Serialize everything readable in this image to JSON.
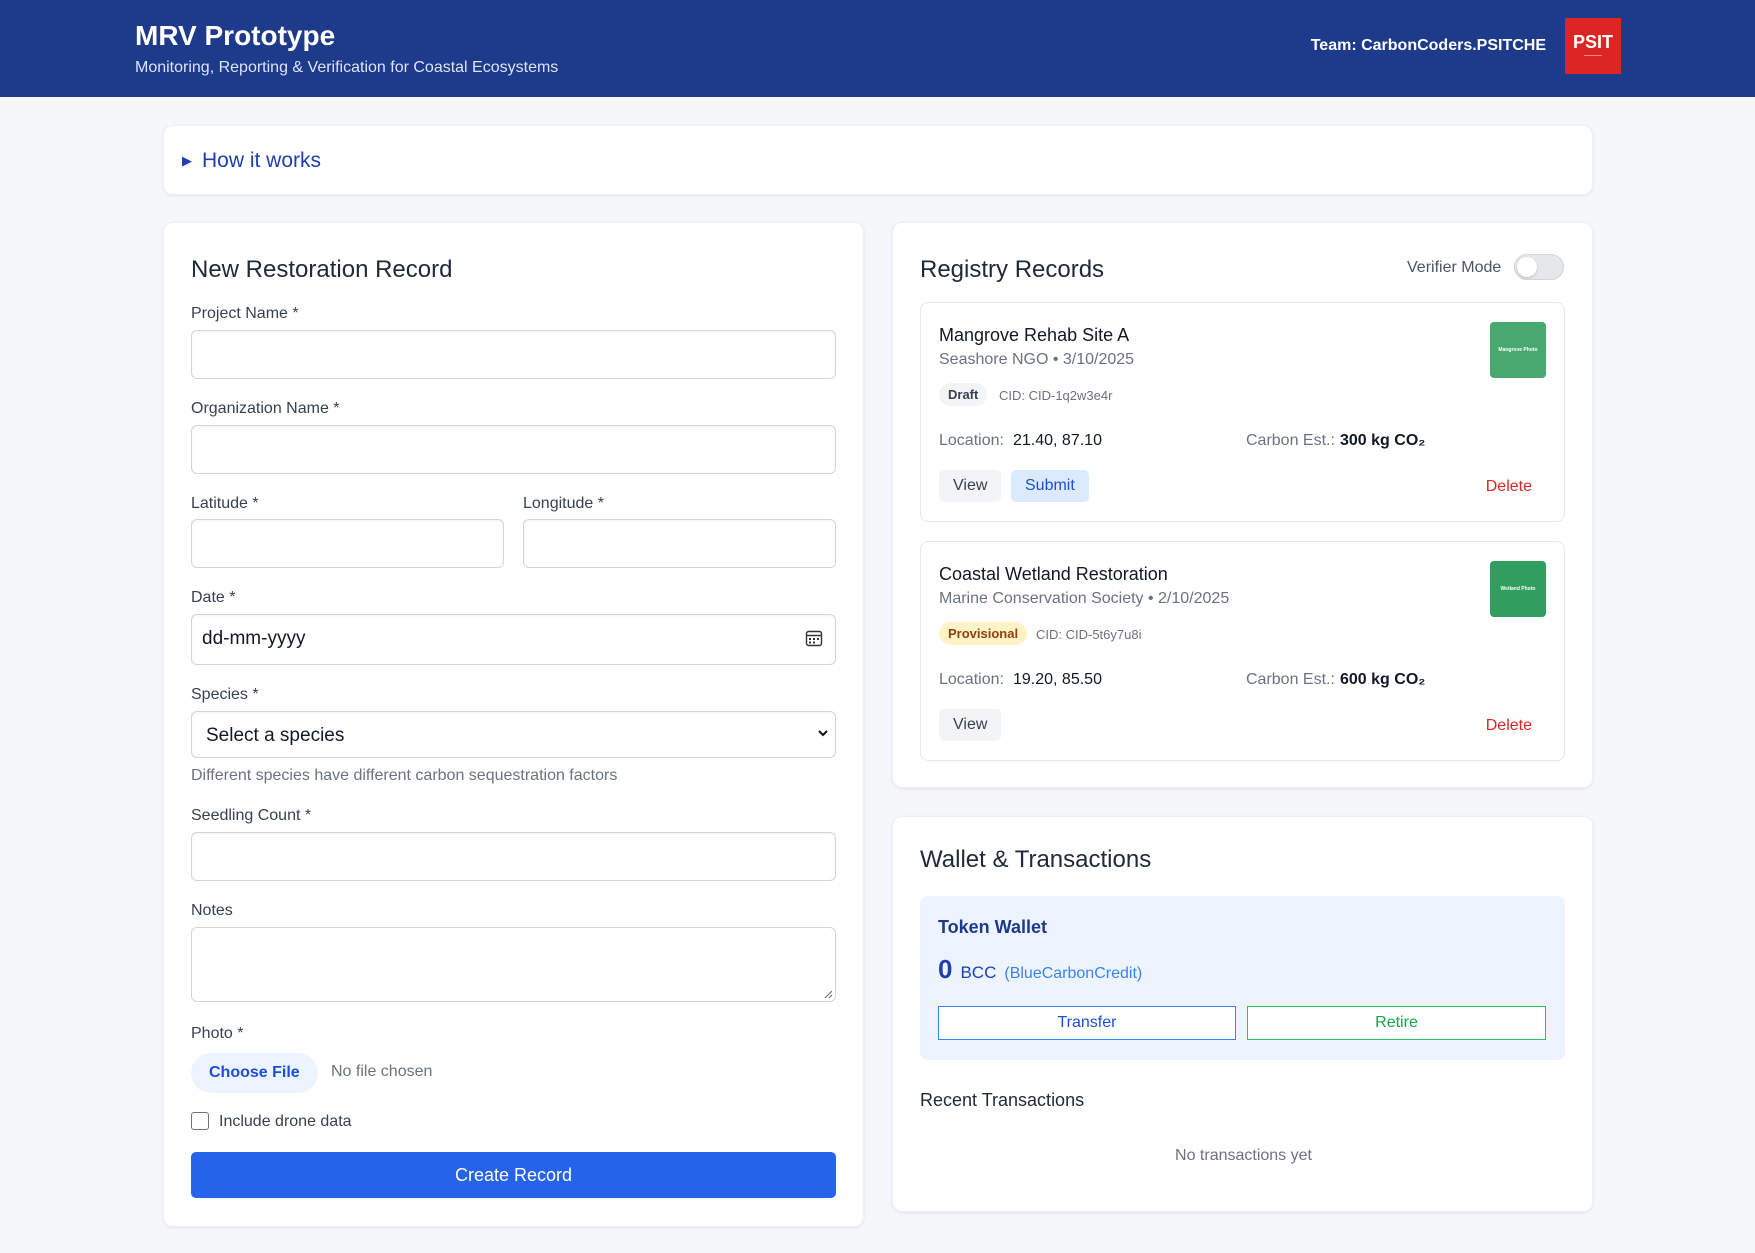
{
  "header": {
    "title": "MRV Prototype",
    "subtitle": "Monitoring, Reporting & Verification for Coastal Ecosystems",
    "team": "Team: CarbonCoders.PSITCHE",
    "logo_text": "PSIT"
  },
  "how_it_works": {
    "label": "How it works"
  },
  "form": {
    "title": "New Restoration Record",
    "project_name_label": "Project Name *",
    "organization_label": "Organization Name *",
    "latitude_label": "Latitude *",
    "longitude_label": "Longitude *",
    "date_label": "Date *",
    "date_placeholder": "dd-mm-yyyy",
    "species_label": "Species *",
    "species_selected": "Select a species",
    "species_help": "Different species have different carbon sequestration factors",
    "seedling_label": "Seedling Count *",
    "notes_label": "Notes",
    "photo_label": "Photo *",
    "choose_file": "Choose File",
    "no_file": "No file chosen",
    "drone_label": "Include drone data",
    "drone_checked": false,
    "submit_label": "Create Record"
  },
  "registry": {
    "title": "Registry Records",
    "verifier_mode_label": "Verifier Mode",
    "verifier_mode_on": false,
    "location_label": "Location:",
    "carbon_label": "Carbon Est.:",
    "view_label": "View",
    "submit_label": "Submit",
    "delete_label": "Delete",
    "records": [
      {
        "name": "Mangrove Rehab Site A",
        "meta": "Seashore NGO • 3/10/2025",
        "status": "Draft",
        "cid": "CID: CID-1q2w3e4r",
        "location": "21.40, 87.10",
        "carbon": "300 kg CO₂",
        "thumb_label": "Mangrove Photo",
        "thumb_color": "#48a970"
      },
      {
        "name": "Coastal Wetland Restoration",
        "meta": "Marine Conservation Society • 2/10/2025",
        "status": "Provisional",
        "cid": "CID: CID-5t6y7u8i",
        "location": "19.20, 85.50",
        "carbon": "600 kg CO₂",
        "thumb_label": "Wetland Photo",
        "thumb_color": "#2f9e5f"
      }
    ]
  },
  "wallet": {
    "title": "Wallet & Transactions",
    "token_wallet_label": "Token Wallet",
    "balance": "0",
    "unit": "BCC",
    "unit_desc": "(BlueCarbonCredit)",
    "transfer_label": "Transfer",
    "retire_label": "Retire",
    "recent_label": "Recent Transactions",
    "empty_label": "No transactions yet"
  }
}
